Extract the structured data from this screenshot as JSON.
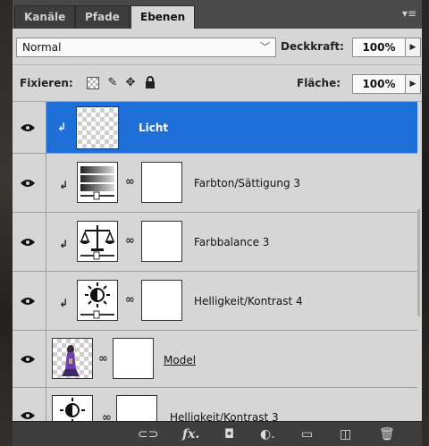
{
  "tabs": [
    {
      "label": "Kanäle"
    },
    {
      "label": "Pfade"
    },
    {
      "label": "Ebenen"
    }
  ],
  "panel_menu_icon": "panel-menu-icon",
  "blend_mode": {
    "value": "Normal"
  },
  "opacity": {
    "label": "Deckkraft:",
    "value": "100%"
  },
  "lock": {
    "label": "Fixieren:",
    "icons": [
      "lock-transparent-pixels-icon",
      "lock-image-pixels-icon",
      "lock-position-icon",
      "lock-all-icon"
    ]
  },
  "fill": {
    "label": "Fläche:",
    "value": "100%"
  },
  "layers": [
    {
      "name": "Licht",
      "selected": true,
      "clipped": true,
      "thumb": "transparent"
    },
    {
      "name": "Farbton/Sättigung 3",
      "clipped": true,
      "thumb": "hue-saturation-adjustment-icon"
    },
    {
      "name": "Farbbalance 3",
      "clipped": true,
      "thumb": "color-balance-adjustment-icon"
    },
    {
      "name": "Helligkeit/Kontrast 4",
      "clipped": true,
      "thumb": "brightness-contrast-adjustment-icon"
    },
    {
      "name": "Model",
      "clipped": false,
      "thumb": "model-image"
    },
    {
      "name": "Helligkeit/Kontrast 3",
      "clipped": false,
      "thumb": "brightness-contrast-adjustment-icon"
    }
  ],
  "bottom_icons": [
    "link-layers-icon",
    "fx-layer-style-icon",
    "add-mask-icon",
    "new-adjustment-layer-icon",
    "new-group-icon",
    "new-layer-icon",
    "delete-layer-icon"
  ],
  "colors": {
    "selection": "#1f6fd8",
    "panel": "#d6d6d6",
    "tabbar": "#4a4a4a"
  }
}
